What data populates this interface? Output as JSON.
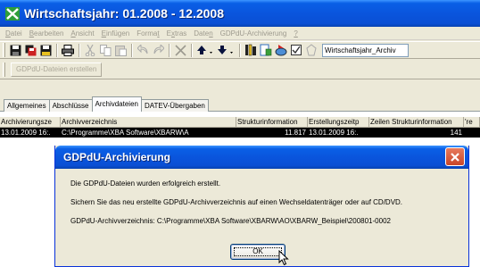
{
  "window": {
    "title": "Wirtschaftsjahr: 01.2008 - 12.2008"
  },
  "menu": [
    {
      "pre": "",
      "u": "D",
      "post": "atei"
    },
    {
      "pre": "",
      "u": "B",
      "post": "earbeiten"
    },
    {
      "pre": "",
      "u": "A",
      "post": "nsicht"
    },
    {
      "pre": "",
      "u": "E",
      "post": "infügen"
    },
    {
      "pre": "Forma",
      "u": "t",
      "post": ""
    },
    {
      "pre": "E",
      "u": "x",
      "post": "tras"
    },
    {
      "pre": "Date",
      "u": "n",
      "post": ""
    },
    {
      "pre": "GDPdU-Archivierung",
      "u": "",
      "post": ""
    },
    {
      "pre": "",
      "u": "?",
      "post": ""
    }
  ],
  "toolbar": {
    "combo_value": "Wirtschaftsjahr_Archiv"
  },
  "toolbar2": {
    "gdpdu_button": "GDPdU-Dateien erstellen"
  },
  "tabs": [
    "Allgemeines",
    "Abschlüsse",
    "Archivdateien",
    "DATEV-Übergaben"
  ],
  "grid": {
    "headers": [
      "Archivierungsze",
      "Archivverzeichnis",
      "Strukturinformation",
      "Erstellungszeitp",
      "Zeilen Strukturinformation",
      "'re"
    ],
    "row": [
      "13.01.2009 16:.",
      "C:\\Programme\\XBA Software\\XBARW\\A",
      "11.817",
      "13.01.2009 16:.",
      "141",
      ""
    ]
  },
  "dialog": {
    "title": "GDPdU-Archivierung",
    "line1": "Die GDPdU-Dateien wurden erfolgreich erstellt.",
    "line2": "Sichern Sie das neu erstellte GDPdU-Archivverzeichnis auf einen Wechseldatenträger oder auf CD/DVD.",
    "line3": "GDPdU-Archivverzeichnis: C:\\Programme\\XBA Software\\XBARW\\AO\\XBARW_Beispiel\\200801-0002",
    "ok_label": "OK"
  }
}
